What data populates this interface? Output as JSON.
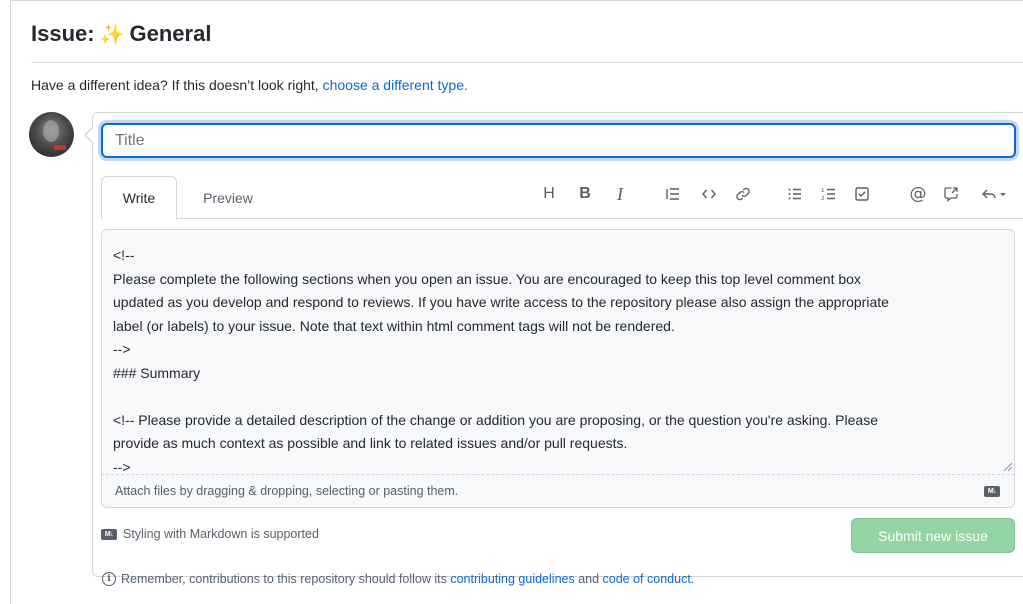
{
  "header": {
    "prefix": "Issue:",
    "sparkles_icon": "✨",
    "title": "General"
  },
  "type_note": {
    "text": "Have a different idea? If this doesn’t look right, ",
    "link": "choose a different type."
  },
  "avatar": {
    "icon": "user-avatar"
  },
  "title_field": {
    "placeholder": "Title",
    "value": ""
  },
  "tabs": [
    {
      "label": "Write",
      "active": true
    },
    {
      "label": "Preview",
      "active": false
    }
  ],
  "toolbar": [
    {
      "name": "heading",
      "glyph": "H"
    },
    {
      "name": "bold",
      "glyph": "B"
    },
    {
      "name": "italic",
      "glyph": "I"
    },
    {
      "name": "quote",
      "glyph": "quote"
    },
    {
      "name": "code",
      "glyph": "<>"
    },
    {
      "name": "link",
      "glyph": "link"
    },
    {
      "name": "bulleted-list",
      "glyph": "ul"
    },
    {
      "name": "numbered-list",
      "glyph": "ol"
    },
    {
      "name": "task-list",
      "glyph": "task"
    },
    {
      "name": "mention",
      "glyph": "@"
    },
    {
      "name": "cross-reference",
      "glyph": "ref"
    },
    {
      "name": "saved-replies",
      "glyph": "reply"
    }
  ],
  "body_text": "<!--\nPlease complete the following sections when you open an issue. You are encouraged to keep this top level comment box\nupdated as you develop and respond to reviews. If you have write access to the repository please also assign the appropriate\nlabel (or labels) to your issue. Note that text within html comment tags will not be rendered.\n-->\n### Summary\n\n<!-- Please provide a detailed description of the change or addition you are proposing, or the question you're asking. Please\nprovide as much context as possible and link to related issues and/or pull requests.\n-->",
  "attach_text": "Attach files by dragging & dropping, selecting or pasting them.",
  "markdown_badge": "M↓",
  "markdown_note": "Styling with Markdown is supported",
  "submit_label": "Submit new issue",
  "footer": {
    "info_glyph": "i",
    "text_before": "Remember, contributions to this repository should follow its ",
    "link_guidelines": "contributing guidelines",
    "text_and": " and ",
    "link_conduct": "code of conduct",
    "text_after": "."
  },
  "colors": {
    "accent": "#0969da",
    "submit_disabled": "#94d3a2",
    "border": "#d0d7de",
    "muted_text": "#57606a"
  }
}
